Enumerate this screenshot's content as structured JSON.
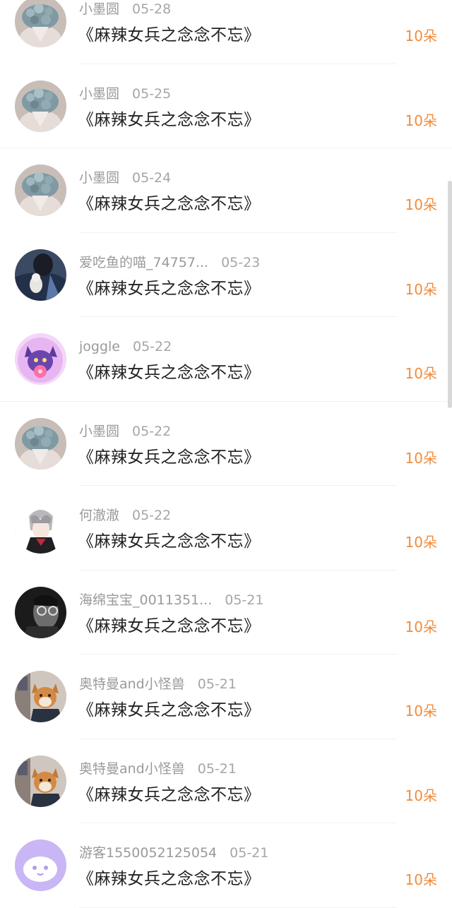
{
  "records": [
    {
      "name": "小墨圆",
      "date": "05-28",
      "title": "《麻辣女兵之念念不忘》",
      "amount": "10朵",
      "avatar_icon": "flowers-avatar-icon"
    },
    {
      "name": "小墨圆",
      "date": "05-25",
      "title": "《麻辣女兵之念念不忘》",
      "amount": "10朵",
      "avatar_icon": "flowers-avatar-icon"
    },
    {
      "name": "小墨圆",
      "date": "05-24",
      "title": "《麻辣女兵之念念不忘》",
      "amount": "10朵",
      "avatar_icon": "flowers-avatar-icon"
    },
    {
      "name": "爱吃鱼的喵_74757...",
      "date": "05-23",
      "title": "《麻辣女兵之念念不忘》",
      "amount": "10朵",
      "avatar_icon": "person-avatar-icon"
    },
    {
      "name": "joggle",
      "date": "05-22",
      "title": "《麻辣女兵之念念不忘》",
      "amount": "10朵",
      "avatar_icon": "cat-avatar-icon"
    },
    {
      "name": "小墨圆",
      "date": "05-22",
      "title": "《麻辣女兵之念念不忘》",
      "amount": "10朵",
      "avatar_icon": "flowers-avatar-icon"
    },
    {
      "name": "何澈澈",
      "date": "05-22",
      "title": "《麻辣女兵之念念不忘》",
      "amount": "10朵",
      "avatar_icon": "anime-avatar-icon"
    },
    {
      "name": "海绵宝宝_0011351...",
      "date": "05-21",
      "title": "《麻辣女兵之念念不忘》",
      "amount": "10朵",
      "avatar_icon": "glasses-avatar-icon"
    },
    {
      "name": "奥特曼and小怪兽",
      "date": "05-21",
      "title": "《麻辣女兵之念念不忘》",
      "amount": "10朵",
      "avatar_icon": "dog-avatar-icon"
    },
    {
      "name": "奥特曼and小怪兽",
      "date": "05-21",
      "title": "《麻辣女兵之念念不忘》",
      "amount": "10朵",
      "avatar_icon": "dog-avatar-icon"
    },
    {
      "name": "游客1550052125054",
      "date": "05-21",
      "title": "《麻辣女兵之念念不忘》",
      "amount": "10朵",
      "avatar_icon": "default-avatar-icon"
    }
  ],
  "colors": {
    "amount": "#f28c3a",
    "name": "#9a9a9a",
    "title": "#222222"
  }
}
